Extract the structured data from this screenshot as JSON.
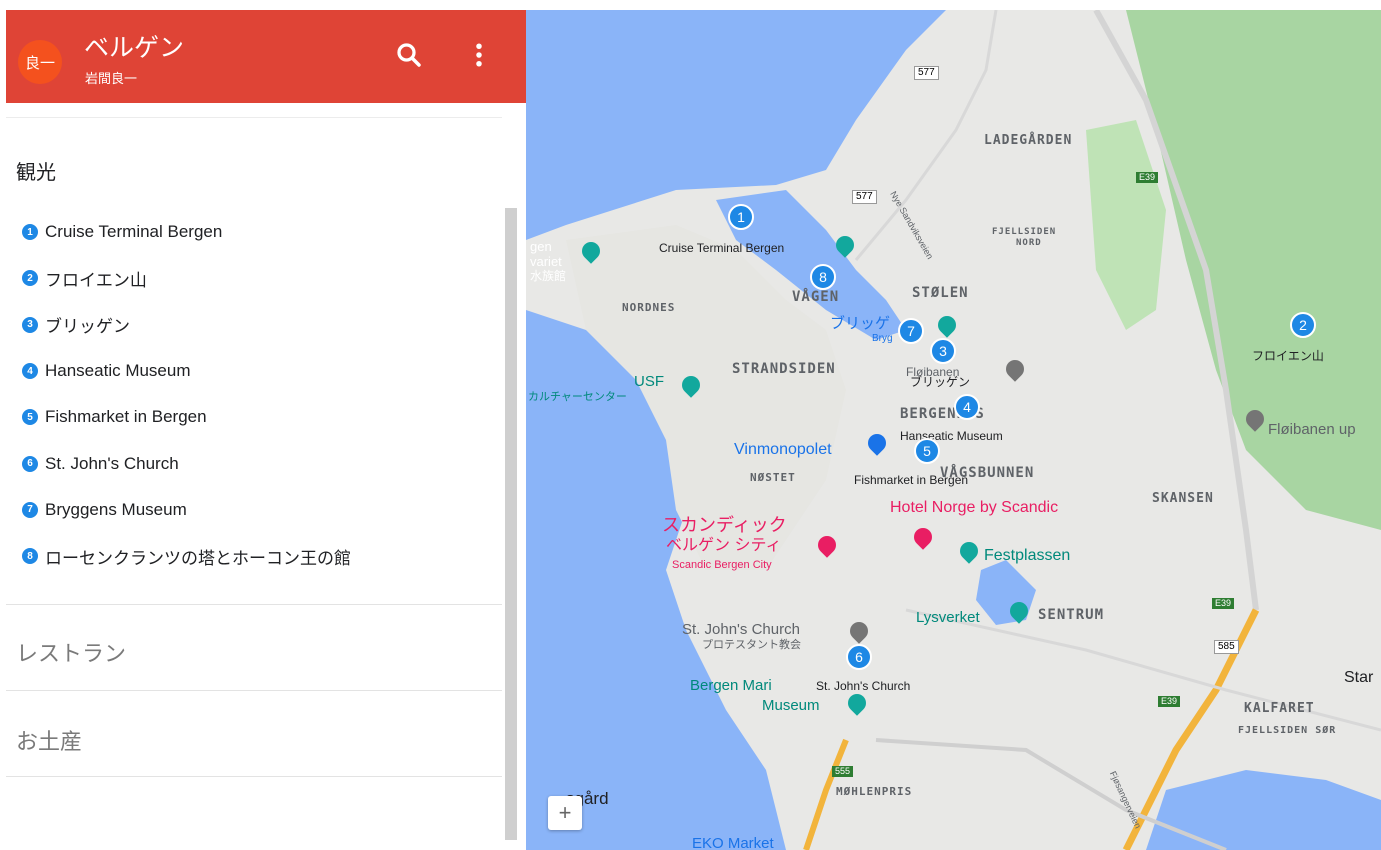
{
  "app": {
    "avatar_text": "良一",
    "title": "ベルゲン",
    "subtitle": "岩間良一"
  },
  "header_icons": [
    "search-icon",
    "more-vert-icon"
  ],
  "sections": {
    "sightseeing": "観光",
    "restaurants": "レストラン",
    "souvenirs": "お土産"
  },
  "places": [
    {
      "num": "1",
      "name": "Cruise Terminal Bergen"
    },
    {
      "num": "2",
      "name": "フロイエン山"
    },
    {
      "num": "3",
      "name": "ブリッゲン"
    },
    {
      "num": "4",
      "name": "Hanseatic Museum"
    },
    {
      "num": "5",
      "name": "Fishmarket in Bergen"
    },
    {
      "num": "6",
      "name": "St. John's Church"
    },
    {
      "num": "7",
      "name": "Bryggens Museum"
    },
    {
      "num": "8",
      "name": "ローセンクランツの塔とホーコン王の館"
    }
  ],
  "map": {
    "districts": {
      "ladegarden": "LADEGÅRDEN",
      "fjellsiden_nord_1": "FJELLSIDEN",
      "fjellsiden_nord_2": "NORD",
      "nordnes": "NORDNES",
      "vagen": "VÅGEN",
      "stolen": "STØLEN",
      "strandsiden": "STRANDSIDEN",
      "bergenhus": "BERGENHUS",
      "vagsbunnen": "VÅGSBUNNEN",
      "nostet": "NØSTET",
      "skansen": "SKANSEN",
      "sentrum": "SENTRUM",
      "kalfaret": "KALFARET",
      "fjellsiden_sor": "FJELLSIDEN SØR",
      "mohlenpris": "MØHLENPRIS"
    },
    "marker_labels": {
      "m1": "Cruise Terminal Bergen",
      "m2": "フロイエン山",
      "m3": "ブリッゲン",
      "m4": "Hanseatic Museum",
      "m5": "Fishmarket in Bergen",
      "m6": "St. John's Church"
    },
    "poi": {
      "akvariet_1": "gen",
      "akvariet_2": "variet",
      "akvariet_3": "水族館",
      "usf": "USF",
      "usf_jp": "カルチャーセンター",
      "vinmonopolet": "Vinmonopolet",
      "hotel_norge": "Hotel Norge by Scandic",
      "scandic_jp_1": "スカンディック",
      "scandic_jp_2": "ベルゲン シティ",
      "scandic_en": "Scandic Bergen City",
      "festplassen": "Festplassen",
      "lysverket": "Lysverket",
      "st_johns": "St. John's Church",
      "st_johns_jp": "プロテスタント教会",
      "bergen_maritime_1": "Bergen Mari",
      "bergen_maritime_2": "Museum",
      "floibanen": "Fløibanen up",
      "floibanen_2": "Fløibanen",
      "bryggen_poi": "ブリッゲ",
      "bryggen_small": "Bryg",
      "ekko": "EKO Market",
      "nygard": "sgård",
      "star": "Star"
    },
    "road_shields": {
      "r577a": "577",
      "r577b": "577",
      "e39a": "E39",
      "e39b": "E39",
      "e39c": "E39",
      "r585": "585",
      "r555": "555"
    },
    "street_labels": {
      "nye_sandviksveien": "Nye Sandviksveien",
      "fjosangerveien": "Fjøsangerveien"
    },
    "colors": {
      "water": "#8ab4f8",
      "park": "#a8d5a2",
      "marker": "#1e88e5",
      "header": "#df4436"
    },
    "zoom_in": "+"
  }
}
